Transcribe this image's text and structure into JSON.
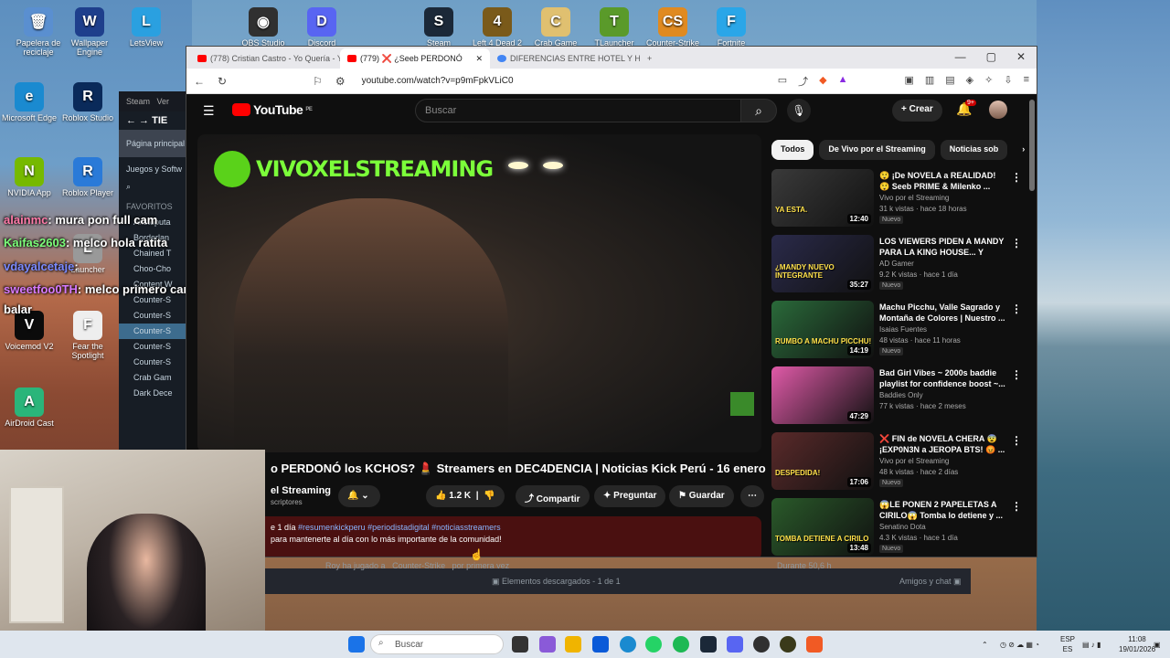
{
  "desktop": {
    "icons": [
      {
        "label": "Papelera de reciclaje",
        "color": "#5a8fd0",
        "glyph": "🗑"
      },
      {
        "label": "Wallpaper Engine",
        "color": "#1e3f8c",
        "glyph": "W"
      },
      {
        "label": "LetsView",
        "color": "#2aa0e0",
        "glyph": "L"
      },
      {
        "label": "OBS Studio",
        "color": "#303030",
        "glyph": "◉"
      },
      {
        "label": "Discord",
        "color": "#5865f2",
        "glyph": "D"
      },
      {
        "label": "Steam",
        "color": "#1b2838",
        "glyph": "S"
      },
      {
        "label": "Left 4 Dead 2",
        "color": "#7a5a1a",
        "glyph": "4"
      },
      {
        "label": "Crab Game",
        "color": "#e0c070",
        "glyph": "C"
      },
      {
        "label": "TLauncher",
        "color": "#5a9a2a",
        "glyph": "T"
      },
      {
        "label": "Counter-Strike 2",
        "color": "#e08a20",
        "glyph": "CS"
      },
      {
        "label": "Fortnite",
        "color": "#2aa6e8",
        "glyph": "F"
      },
      {
        "label": "Microsoft Edge",
        "color": "#1a8ad0",
        "glyph": "e"
      },
      {
        "label": "Roblox Studio",
        "color": "#0a2a5a",
        "glyph": "R"
      },
      {
        "label": "NVIDIA App",
        "color": "#76b900",
        "glyph": "N"
      },
      {
        "label": "Roblox Player",
        "color": "#2a7ad8",
        "glyph": "R"
      },
      {
        "label": "Voicemod V2",
        "color": "#0b0b0b",
        "glyph": "V"
      },
      {
        "label": "Fear the Spotlight",
        "color": "#eeeeee",
        "glyph": "F"
      },
      {
        "label": "AirDroid Cast",
        "color": "#2ab57a",
        "glyph": "A"
      },
      {
        "label": "Launcher",
        "color": "#999999",
        "glyph": "L"
      }
    ]
  },
  "steam": {
    "title": "Steam",
    "menu2": "Ver",
    "heading": "TIE",
    "home": "Página principal",
    "games": "Juegos y Softw",
    "favorites": "FAVORITOS",
    "items": [
      "Aristoputa",
      "Borderlan",
      "Chained T",
      "Choo-Cho",
      "Content W",
      "Counter-S",
      "Counter-S",
      "Counter-S",
      "Counter-S",
      "Counter-S",
      "Crab Gam",
      "Dark Dece"
    ],
    "footer": {
      "activity": "Roy ha jugado a",
      "game": "Counter-Strike",
      "suffix": "por primera vez",
      "downloads": "Elementos descargados - 1 de 1",
      "friends": "Amigos y chat",
      "recent": "Durante 50,6 h"
    }
  },
  "chat_overlay": [
    {
      "user": "alainmc",
      "msg": ": mura pon full cam",
      "color": "#ff7aa8"
    },
    {
      "user": "Kaifas2603",
      "msg": ": melco hola ratita",
      "color": "#7cff7a"
    },
    {
      "user": "vdayalcetaje",
      "msg": ":",
      "color": "#7a8aff"
    },
    {
      "user": "sweetfoo0TH",
      "msg": ": melco primero cambiate ese polo pon uno que muestre las",
      "color": "#d77aff"
    },
    {
      "user": "",
      "msg": "balar",
      "color": "#ffffff"
    }
  ],
  "browser": {
    "tabs": [
      {
        "title": "(778) Cristian Castro - Yo Quería - Yo"
      },
      {
        "title": "(779) ❌ ¿Seeb PERDONÓ"
      },
      {
        "title": "DIFERENCIAS ENTRE HOTEL Y HOSTA"
      }
    ],
    "url": "youtube.com/watch?v=p9mFpkVLiC0"
  },
  "youtube": {
    "logo": "YouTube",
    "region": "PE",
    "search_placeholder": "Buscar",
    "create_label": "Crear",
    "notif_count": "9+",
    "video": {
      "title": "o PERDONÓ los KCHOS? 💄 Streamers en DEC4DENCIA | Noticias Kick Perú - 16 enero",
      "channel": "el Streaming",
      "subs": "scriptores",
      "likes": "1.2 K",
      "share": "Compartir",
      "ask": "Preguntar",
      "save": "Guardar",
      "desc_age": "e 1 día",
      "desc_tags": "#resumenkickperu #periodistadigital #noticiasstreamers",
      "desc_text": "para mantenerte al día con lo más importante de la comunidad!",
      "brand_text": "VIVOXELSTREAMING"
    },
    "chips": [
      "Todos",
      "De Vivo por el Streaming",
      "Noticias sob"
    ],
    "recommendations": [
      {
        "title": "😲 ¡De NOVELA a REALIDAD! 😲 Seeb PRIME & Milenko ...",
        "channel": "Vivo por el Streaming",
        "views": "31 k vistas · hace 18 horas",
        "badge": "Nuevo",
        "duration": "12:40",
        "thumb_text": "YA ESTA.",
        "color": "#3a3a3a"
      },
      {
        "title": "LOS VIEWERS PIDEN A MANDY PARA LA KING HOUSE... Y TEK...",
        "channel": "AD Gamer",
        "views": "9.2 K vistas · hace 1 día",
        "badge": "Nuevo",
        "duration": "35:27",
        "thumb_text": "¿MANDY NUEVO INTEGRANTE",
        "color": "#2a2a4a"
      },
      {
        "title": "Machu Picchu, Valle Sagrado y Montaña de Colores | Nuestro ...",
        "channel": "Isaias Fuentes",
        "views": "48 vistas · hace 11 horas",
        "badge": "Nuevo",
        "duration": "14:19",
        "thumb_text": "RUMBO A MACHU PICCHU!",
        "color": "#2a6a3a"
      },
      {
        "title": "Bad Girl Vibes ~ 2000s baddie playlist for confidence boost ~...",
        "channel": "Baddies Only",
        "views": "77 k vistas · hace 2 meses",
        "badge": "",
        "duration": "47:29",
        "thumb_text": "",
        "color": "#e05aa8"
      },
      {
        "title": "❌ FIN de NOVELA CHERA 😨 ¡EXP0N3N a JEROPA BTS! 😡 ...",
        "channel": "Vivo por el Streaming",
        "views": "48 k vistas · hace 2 días",
        "badge": "Nuevo",
        "duration": "17:06",
        "thumb_text": "DESPEDIDA!",
        "color": "#5a2a2a"
      },
      {
        "title": "😱LE PONEN 2 PAPELETAS A CIRILO😱 Tomba lo detiene y ...",
        "channel": "Senatino Dota",
        "views": "4.3 K vistas · hace 1 día",
        "badge": "Nuevo",
        "duration": "13:48",
        "thumb_text": "TOMBA DETIENE A CIRILO",
        "color": "#2a5a2a"
      }
    ]
  },
  "taskbar": {
    "search": "Buscar",
    "lang_top": "ESP",
    "lang_bottom": "ES",
    "time": "11:08",
    "date": "19/01/2026"
  }
}
